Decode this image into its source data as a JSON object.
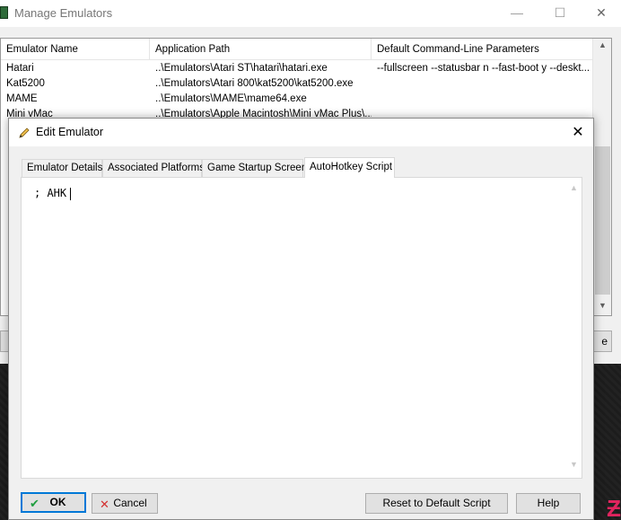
{
  "background_window": {
    "title": "Manage Emulators",
    "minimize": "—",
    "maximize": "☐",
    "close": "✕",
    "columns": [
      "Emulator Name",
      "Application Path",
      "Default Command-Line Parameters"
    ],
    "rows": [
      {
        "name": "Hatari",
        "path": "..\\Emulators\\Atari ST\\hatari\\hatari.exe",
        "params": "--fullscreen --statusbar n --fast-boot y --deskt..."
      },
      {
        "name": "Kat5200",
        "path": "..\\Emulators\\Atari 800\\kat5200\\kat5200.exe",
        "params": ""
      },
      {
        "name": "MAME",
        "path": "..\\Emulators\\MAME\\mame64.exe",
        "params": ""
      },
      {
        "name": "Mini vMac",
        "path": "..\\Emulators\\Apple Macintosh\\Mini vMac Plus\\...",
        "params": ""
      }
    ],
    "partial_right_button": "e",
    "scroll_up": "▲",
    "scroll_down": "▼"
  },
  "dialog": {
    "title": "Edit Emulator",
    "close": "✕",
    "tabs": [
      {
        "label": "Emulator Details",
        "active": false
      },
      {
        "label": "Associated Platforms",
        "active": false
      },
      {
        "label": "Game Startup Screen",
        "active": false
      },
      {
        "label": "AutoHotkey Script",
        "active": true
      }
    ],
    "script_text": "; AHK",
    "scroll_up": "▲",
    "scroll_down": "▼",
    "buttons": {
      "ok": "OK",
      "cancel": "Cancel",
      "reset": "Reset to Default Script",
      "help": "Help"
    },
    "ok_icon": "✔",
    "cancel_icon": "✕"
  },
  "colors": {
    "accent": "#0078d7",
    "ok_check": "#1f9e3f",
    "cancel_x": "#d32f2f"
  },
  "corner_logo": "Ƶ"
}
